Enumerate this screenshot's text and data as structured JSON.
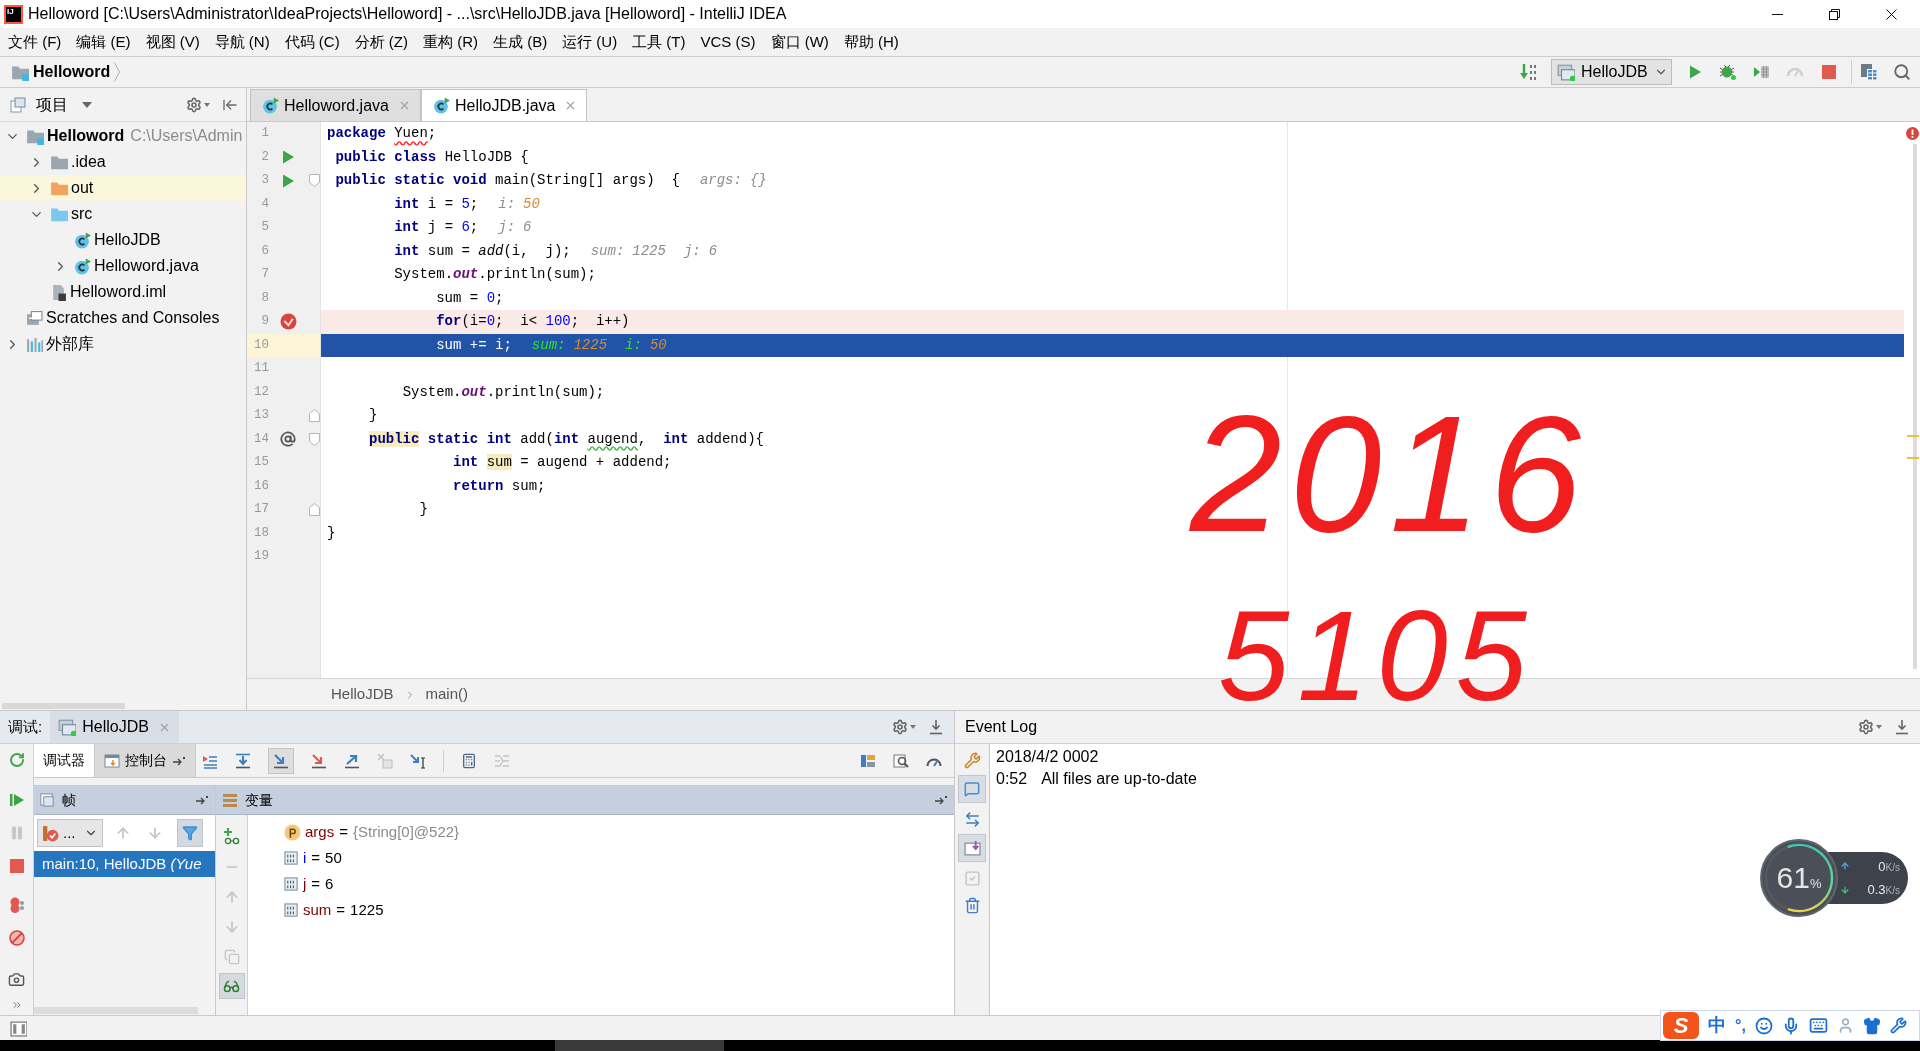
{
  "window": {
    "icon_text": "IJ",
    "title": "Helloword [C:\\Users\\Administrator\\IdeaProjects\\Helloword] - ...\\src\\HelloJDB.java [Helloword] - IntelliJ IDEA"
  },
  "menu": [
    "文件 (F)",
    "编辑 (E)",
    "视图 (V)",
    "导航 (N)",
    "代码 (C)",
    "分析 (Z)",
    "重构 (R)",
    "生成 (B)",
    "运行 (U)",
    "工具 (T)",
    "VCS (S)",
    "窗口 (W)",
    "帮助 (H)"
  ],
  "navigation": {
    "breadcrumb": "Helloword",
    "run_configuration": "HelloJDB"
  },
  "project_panel": {
    "title": "项目",
    "tree": [
      {
        "label": "Helloword",
        "detail": "C:\\Users\\Admin",
        "kind": "project",
        "expanded": true,
        "highlighted": false,
        "children": [
          {
            "label": ".idea",
            "kind": "folder",
            "expanded": false,
            "highlighted": false
          },
          {
            "label": "out",
            "kind": "excluded_folder",
            "expanded": false,
            "highlighted": true
          },
          {
            "label": "src",
            "kind": "source_folder",
            "expanded": true,
            "highlighted": false,
            "children": [
              {
                "label": "HelloJDB",
                "kind": "class",
                "highlighted": false
              },
              {
                "label": "Helloword.java",
                "kind": "class",
                "expanded": false,
                "highlighted": false
              }
            ]
          },
          {
            "label": "Helloword.iml",
            "kind": "module_file",
            "highlighted": false
          }
        ]
      },
      {
        "label": "Scratches and Consoles",
        "kind": "scratches",
        "highlighted": false
      },
      {
        "label": "外部库",
        "kind": "library",
        "expanded": false,
        "highlighted": false
      }
    ]
  },
  "editor": {
    "tabs": [
      {
        "label": "Helloword.java",
        "selected": false
      },
      {
        "label": "HelloJDB.java",
        "selected": true
      }
    ],
    "lines": [
      {
        "number": "1",
        "kind": "plain",
        "tokens": [
          {
            "text": "package ",
            "kind": "keyword"
          },
          {
            "text": "Yuen",
            "kind": "error"
          },
          {
            "text": ";",
            "kind": "plain"
          }
        ]
      },
      {
        "number": "2",
        "kind": "plain",
        "gutter": {
          "kind": "run"
        },
        "tokens": [
          {
            "text": " public class ",
            "kind": "keyword"
          },
          {
            "text": "HelloJDB {",
            "kind": "plain"
          }
        ]
      },
      {
        "number": "3",
        "kind": "plain",
        "gutter": {
          "kind": "run"
        },
        "fold": {
          "kind": "start"
        },
        "tokens": [
          {
            "text": " public static void ",
            "kind": "keyword"
          },
          {
            "text": "main(String[] args)  {",
            "kind": "plain"
          }
        ],
        "hints": [
          {
            "name": "args:",
            "value": "{}",
            "changed": false
          }
        ]
      },
      {
        "number": "4",
        "kind": "plain",
        "tokens": [
          {
            "text": "        int ",
            "kind": "keyword"
          },
          {
            "text": "i = ",
            "kind": "plain"
          },
          {
            "text": "5",
            "kind": "number"
          },
          {
            "text": ";",
            "kind": "plain"
          }
        ],
        "hints": [
          {
            "name": "i:",
            "value": "50",
            "changed": true
          }
        ]
      },
      {
        "number": "5",
        "kind": "plain",
        "tokens": [
          {
            "text": "        int ",
            "kind": "keyword"
          },
          {
            "text": "j = ",
            "kind": "plain"
          },
          {
            "text": "6",
            "kind": "number"
          },
          {
            "text": ";",
            "kind": "plain"
          }
        ],
        "hints": [
          {
            "name": "j:",
            "value": "6",
            "changed": false
          }
        ]
      },
      {
        "number": "6",
        "kind": "plain",
        "tokens": [
          {
            "text": "        int ",
            "kind": "keyword"
          },
          {
            "text": "sum = ",
            "kind": "plain"
          },
          {
            "text": "add",
            "kind": "call"
          },
          {
            "text": "(i,  j);",
            "kind": "plain"
          }
        ],
        "hints": [
          {
            "name": "sum:",
            "value": "1225",
            "changed": false
          },
          {
            "name": "j:",
            "value": "6",
            "changed": false
          }
        ]
      },
      {
        "number": "7",
        "kind": "plain",
        "tokens": [
          {
            "text": "        System.",
            "kind": "plain"
          },
          {
            "text": "out",
            "kind": "field"
          },
          {
            "text": ".println(sum);",
            "kind": "plain"
          }
        ]
      },
      {
        "number": "8",
        "kind": "plain",
        "tokens": [
          {
            "text": "             sum = ",
            "kind": "plain"
          },
          {
            "text": "0",
            "kind": "number"
          },
          {
            "text": ";",
            "kind": "plain"
          }
        ]
      },
      {
        "number": "9",
        "kind": "breakpoint",
        "gutter": {
          "kind": "breakpoint"
        },
        "tokens": [
          {
            "text": "             for",
            "kind": "keyword"
          },
          {
            "text": "(i=",
            "kind": "plain"
          },
          {
            "text": "0",
            "kind": "number"
          },
          {
            "text": ";  i< ",
            "kind": "plain"
          },
          {
            "text": "100",
            "kind": "number"
          },
          {
            "text": ";  i++)",
            "kind": "plain"
          }
        ]
      },
      {
        "number": "10",
        "kind": "current",
        "tokens": [
          {
            "text": "             sum += i;",
            "kind": "plain"
          }
        ],
        "hints": [
          {
            "name": "sum:",
            "value": "1225",
            "changed": true
          },
          {
            "name": "i:",
            "value": "50",
            "changed": true
          }
        ]
      },
      {
        "number": "11",
        "kind": "plain"
      },
      {
        "number": "12",
        "kind": "plain",
        "tokens": [
          {
            "text": "         System.",
            "kind": "plain"
          },
          {
            "text": "out",
            "kind": "field"
          },
          {
            "text": ".println(sum);",
            "kind": "plain"
          }
        ]
      },
      {
        "number": "13",
        "kind": "plain",
        "fold": {
          "kind": "end"
        },
        "tokens": [
          {
            "text": "     }",
            "kind": "plain"
          }
        ]
      },
      {
        "number": "14",
        "kind": "plain",
        "gutter": {
          "kind": "implements"
        },
        "fold": {
          "kind": "start"
        },
        "tokens": [
          {
            "text": "     public",
            "kind": "keyword",
            "marked": true
          },
          {
            "text": " static int ",
            "kind": "keyword"
          },
          {
            "text": "add(",
            "kind": "plain"
          },
          {
            "text": "int ",
            "kind": "keyword"
          },
          {
            "text": "augend",
            "kind": "typo"
          },
          {
            "text": ",  ",
            "kind": "plain"
          },
          {
            "text": "int ",
            "kind": "keyword"
          },
          {
            "text": "addend){",
            "kind": "plain"
          }
        ]
      },
      {
        "number": "15",
        "kind": "plain",
        "tokens": [
          {
            "text": "               int ",
            "kind": "keyword"
          },
          {
            "text": "sum",
            "kind": "plain",
            "marked": true
          },
          {
            "text": " = augend + addend;",
            "kind": "plain"
          }
        ]
      },
      {
        "number": "16",
        "kind": "plain",
        "tokens": [
          {
            "text": "               return ",
            "kind": "keyword"
          },
          {
            "text": "sum;",
            "kind": "plain"
          }
        ]
      },
      {
        "number": "17",
        "kind": "plain",
        "fold": {
          "kind": "end"
        },
        "tokens": [
          {
            "text": "           }",
            "kind": "plain"
          }
        ]
      },
      {
        "number": "18",
        "kind": "plain",
        "tokens": [
          {
            "text": "}",
            "kind": "plain"
          }
        ]
      },
      {
        "number": "19",
        "kind": "plain"
      }
    ],
    "breadcrumb": [
      "HelloJDB",
      "main()"
    ]
  },
  "annotation": [
    "2016",
    "5105"
  ],
  "debug": {
    "label": "调试:",
    "session_tab": "HelloJDB",
    "tabs": [
      {
        "label": "调试器",
        "selected": true
      },
      {
        "label": "控制台",
        "selected": false
      }
    ],
    "frames": {
      "title": "帧",
      "thread": "...",
      "items": [
        {
          "text": "main:10, HelloJDB *(Yue*",
          "selected": true
        }
      ]
    },
    "variables": {
      "title": "变量",
      "items": [
        {
          "kind": "parameter",
          "name": "args",
          "operator": "=",
          "value": "{String[0]@522}",
          "color": "#800000"
        },
        {
          "kind": "local",
          "name": "i",
          "operator": "=",
          "value": "50",
          "color": "#0000ff"
        },
        {
          "kind": "local",
          "name": "j",
          "operator": "=",
          "value": "6",
          "color": "#800000"
        },
        {
          "kind": "local",
          "name": "sum",
          "operator": "=",
          "value": "1225",
          "color": "#800000"
        }
      ]
    }
  },
  "event_log": {
    "title": "Event Log",
    "entries": [
      {
        "date": "2018/4/2 0002",
        "time": "0:52",
        "message": "All files are up-to-date"
      }
    ]
  },
  "network_monitor": {
    "percent": "61",
    "percent_unit": "%",
    "level": 0.61,
    "upload": {
      "value": "0",
      "unit": "K/s"
    },
    "download": {
      "value": "0.3",
      "unit": "K/s"
    }
  },
  "ime_toolbar": {
    "logo": "S",
    "mode": "中",
    "punctuation": "°,"
  }
}
